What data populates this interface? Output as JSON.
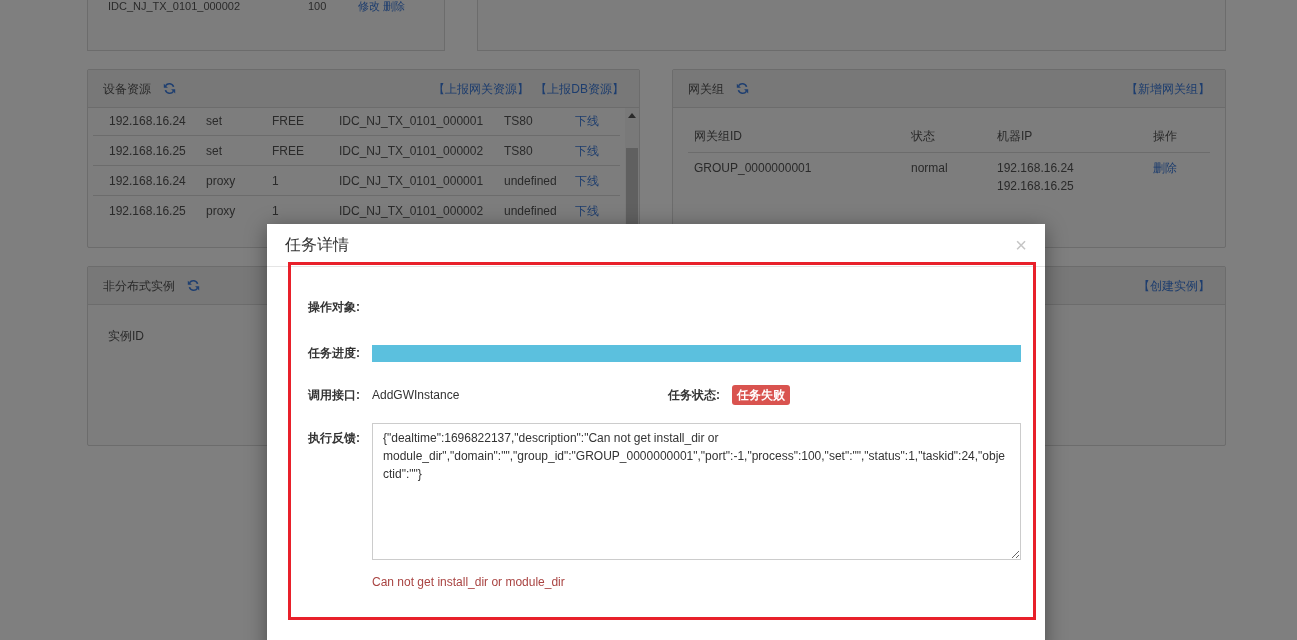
{
  "top_left_panel": {
    "cells": [
      "IDC_NJ_TX_0101_000002",
      "100"
    ],
    "actions": [
      "修改",
      "删除"
    ]
  },
  "device_panel": {
    "title": "设备资源",
    "links": [
      "【上报网关资源】",
      "【上报DB资源】"
    ],
    "rows": [
      [
        "192.168.16.24",
        "set",
        "FREE",
        "IDC_NJ_TX_0101_000001",
        "TS80",
        "下线"
      ],
      [
        "192.168.16.25",
        "set",
        "FREE",
        "IDC_NJ_TX_0101_000002",
        "TS80",
        "下线"
      ],
      [
        "192.168.16.24",
        "proxy",
        "1",
        "IDC_NJ_TX_0101_000001",
        "undefined",
        "下线"
      ],
      [
        "192.168.16.25",
        "proxy",
        "1",
        "IDC_NJ_TX_0101_000002",
        "undefined",
        "下线"
      ]
    ]
  },
  "gateway_panel": {
    "title": "网关组",
    "links": [
      "【新增网关组】"
    ],
    "columns": [
      "网关组ID",
      "状态",
      "机器IP",
      "操作"
    ],
    "rows": [
      {
        "id": "GROUP_0000000001",
        "status": "normal",
        "ips": [
          "192.168.16.24",
          "192.168.16.25"
        ],
        "action": "删除"
      }
    ]
  },
  "instance_panel": {
    "title": "非分布式实例",
    "links": [
      "【创建实例】"
    ],
    "columns": [
      "实例ID"
    ]
  },
  "dialog": {
    "title": "任务详情",
    "close": "×",
    "object_label": "操作对象:",
    "progress_label": "任务进度:",
    "progress": {
      "level": 1
    },
    "api_label": "调用接口:",
    "api": "AddGWInstance",
    "status_label": "任务状态:",
    "status": "任务失败",
    "feedback_label": "执行反馈:",
    "feedback": "{\"dealtime\":1696822137,\"description\":\"Can not get install_dir or module_dir\",\"domain\":\"\",\"group_id\":\"GROUP_0000000001\",\"port\":-1,\"process\":100,\"set\":\"\",\"status\":1,\"taskid\":24,\"objectid\":\"\"}",
    "error": "Can not get install_dir or module_dir"
  }
}
